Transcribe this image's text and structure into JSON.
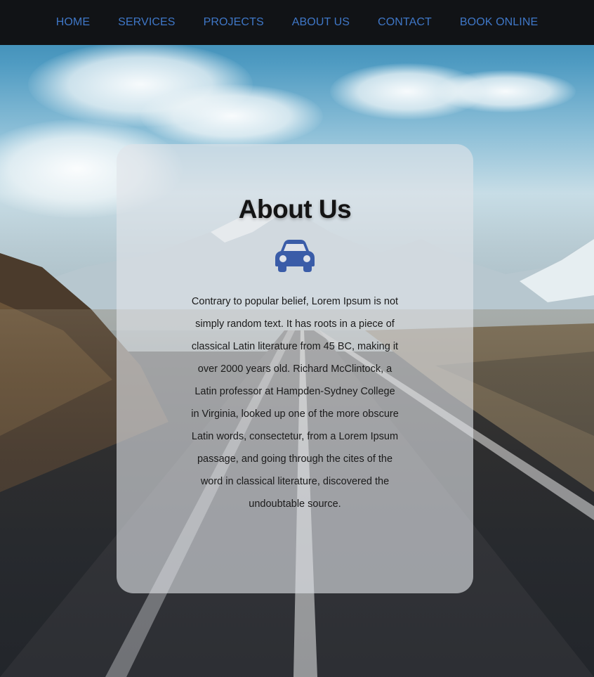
{
  "nav": {
    "items": [
      {
        "label": "HOME"
      },
      {
        "label": "SERVICES"
      },
      {
        "label": "PROJECTS"
      },
      {
        "label": "ABOUT US"
      },
      {
        "label": "CONTACT"
      },
      {
        "label": "BOOK ONLINE"
      }
    ]
  },
  "about": {
    "title": "About Us",
    "icon": "car-icon",
    "body": "Contrary to popular belief, Lorem Ipsum is not simply random text. It has roots in a piece of classical Latin literature from 45 BC, making it over 2000 years old. Richard McClintock, a Latin professor at Hampden-Sydney College in Virginia, looked up one of the more obscure Latin words, consectetur, from a Lorem Ipsum passage, and going through the cites of the word in classical literature, discovered the undoubtable source."
  },
  "colors": {
    "nav_background": "#111316",
    "nav_link": "#3f77c7",
    "icon": "#3a5ca8",
    "card_background": "rgba(225,228,232,0.62)"
  },
  "background_image": "mountain-road-landscape"
}
